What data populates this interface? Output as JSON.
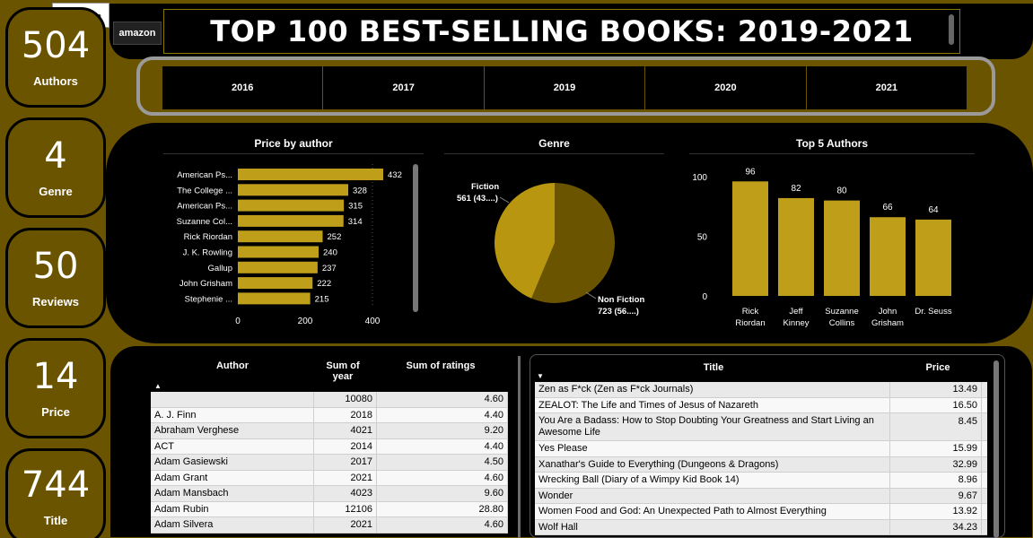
{
  "kpis": [
    {
      "value": "504",
      "label": "Authors"
    },
    {
      "value": "4",
      "label": "Genre"
    },
    {
      "value": "50",
      "label": "Reviews"
    },
    {
      "value": "14",
      "label": "Price"
    },
    {
      "value": "744",
      "label": "Title"
    }
  ],
  "toolbar": {
    "filter_icon": "filter-lines-icon",
    "more_icon": "more-dots-icon"
  },
  "header": {
    "logo": "amazon",
    "title": "TOP 100 BEST-SELLING  BOOKS: 2019-2021"
  },
  "years": [
    "2016",
    "2017",
    "2019",
    "2020",
    "2021"
  ],
  "charts": {
    "price_by_author_title": "Price by author",
    "genre_title": "Genre",
    "top5_title": "Top 5 Authors"
  },
  "chart_data": [
    {
      "type": "bar",
      "orientation": "horizontal",
      "title": "Price by author",
      "categories": [
        "American Ps...",
        "The College ...",
        "American Ps...",
        "Suzanne Col...",
        "Rick Riordan",
        "J. K. Rowling",
        "Gallup",
        "John Grisham",
        "Stephenie ..."
      ],
      "values": [
        432,
        328,
        315,
        314,
        252,
        240,
        237,
        222,
        215
      ],
      "xticks": [
        "0",
        "200",
        "400"
      ],
      "xlim": [
        0,
        460
      ],
      "color": "#bf9f1a"
    },
    {
      "type": "pie",
      "title": "Genre",
      "labels": [
        "Fiction",
        "Non Fiction"
      ],
      "values": [
        561,
        723
      ],
      "data_labels": [
        "561 (43....)",
        "723 (56....)"
      ],
      "colors": [
        "#b8960f",
        "#6b5400"
      ]
    },
    {
      "type": "bar",
      "title": "Top 5 Authors",
      "categories": [
        "Rick Riordan",
        "Jeff Kinney",
        "Suzanne Collins",
        "John Grisham",
        "Dr. Seuss"
      ],
      "category_lines": [
        [
          "Rick",
          "Riordan"
        ],
        [
          "Jeff",
          "Kinney"
        ],
        [
          "Suzanne",
          "Collins"
        ],
        [
          "John",
          "Grisham"
        ],
        [
          "Dr. Seuss"
        ]
      ],
      "values": [
        96,
        82,
        80,
        66,
        64
      ],
      "yticks": [
        "0",
        "50",
        "100"
      ],
      "ylim": [
        0,
        100
      ],
      "color": "#bf9f1a"
    }
  ],
  "author_table": {
    "headers": [
      "Author",
      "Sum of year",
      "Sum of ratings"
    ],
    "header_lines": [
      [
        "Author"
      ],
      [
        "Sum of",
        "year"
      ],
      [
        "Sum of ratings"
      ]
    ],
    "rows": [
      [
        "",
        "10080",
        "4.60"
      ],
      [
        "A. J. Finn",
        "2018",
        "4.40"
      ],
      [
        "Abraham Verghese",
        "4021",
        "9.20"
      ],
      [
        "ACT",
        "2014",
        "4.40"
      ],
      [
        "Adam Gasiewski",
        "2017",
        "4.50"
      ],
      [
        "Adam Grant",
        "2021",
        "4.60"
      ],
      [
        "Adam Mansbach",
        "4023",
        "9.60"
      ],
      [
        "Adam Rubin",
        "12106",
        "28.80"
      ],
      [
        "Adam Silvera",
        "2021",
        "4.60"
      ]
    ]
  },
  "title_table": {
    "headers": [
      "Title",
      "Price"
    ],
    "rows": [
      [
        "Zen as F*ck (Zen as F*ck Journals)",
        "13.49"
      ],
      [
        "ZEALOT: The Life and Times of Jesus of Nazareth",
        "16.50"
      ],
      [
        "You Are a Badass: How to Stop Doubting Your Greatness and Start Living an Awesome Life",
        "8.45"
      ],
      [
        "Yes Please",
        "15.99"
      ],
      [
        "Xanathar's Guide to Everything (Dungeons & Dragons)",
        "32.99"
      ],
      [
        "Wrecking Ball (Diary of a Wimpy Kid Book 14)",
        "8.96"
      ],
      [
        "Wonder",
        "9.67"
      ],
      [
        "Women Food and God: An Unexpected Path to Almost Everything",
        "13.92"
      ],
      [
        "Wolf Hall",
        "34.23"
      ]
    ]
  }
}
